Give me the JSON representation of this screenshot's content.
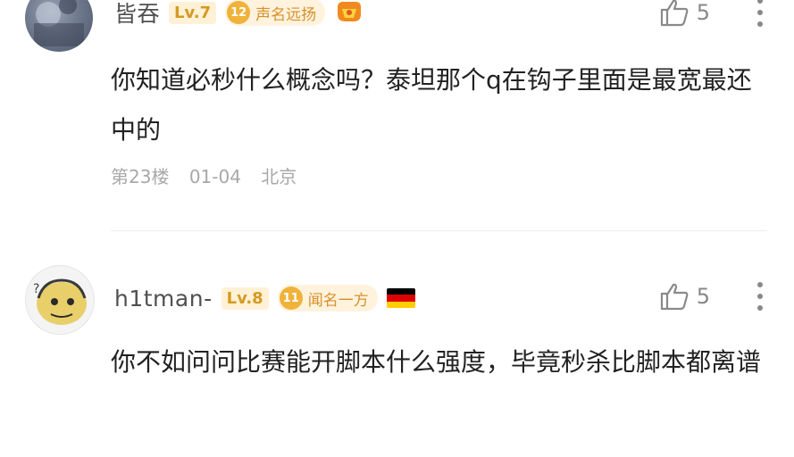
{
  "comments": [
    {
      "username": "皆吞",
      "level": "Lv.7",
      "fan_badge": {
        "number": "12",
        "title": "声名远扬"
      },
      "like_count": "5",
      "text": "你知道必秒什么概念吗？泰坦那个q在钩子里面是最宽最还中的",
      "floor": "第23楼",
      "date": "01-04",
      "location": "北京"
    },
    {
      "username": "h1tman-",
      "level": "Lv.8",
      "fan_badge": {
        "number": "11",
        "title": "闻名一方"
      },
      "like_count": "5",
      "text": "你不如问问比赛能开脚本什么强度，毕竟秒杀比脚本都离谱",
      "flag_colors": [
        "#000000",
        "#dd0000",
        "#ffce00"
      ]
    }
  ]
}
